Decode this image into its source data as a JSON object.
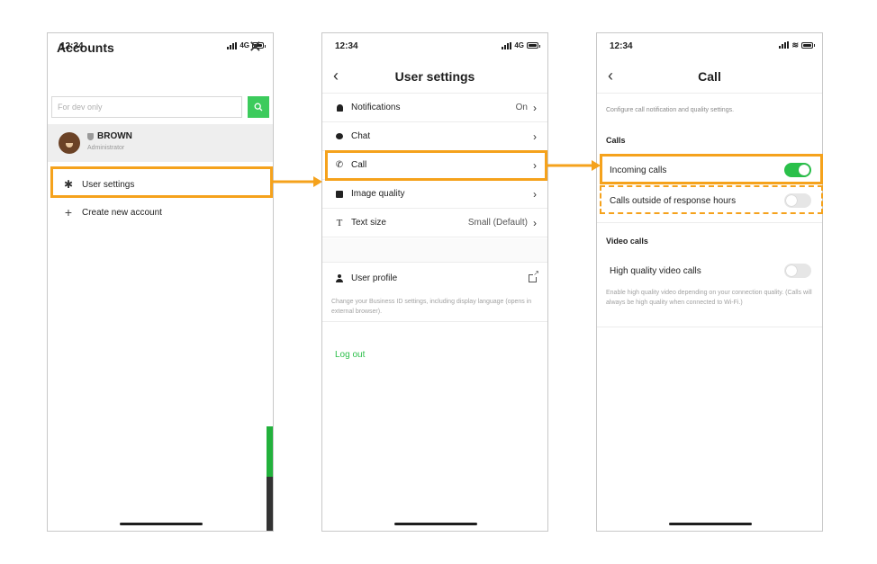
{
  "screens": {
    "accounts": {
      "status": {
        "time": "12:34",
        "network": "4G"
      },
      "title": "Accounts",
      "search": {
        "placeholder": "For dev only",
        "icon": "search-icon"
      },
      "account": {
        "name": "BROWN",
        "role": "Administrator"
      },
      "menu": {
        "user_settings": "User settings",
        "create_account": "Create new account"
      }
    },
    "user_settings": {
      "status": {
        "time": "12:34",
        "network": "4G"
      },
      "title": "User settings",
      "rows": [
        {
          "label": "Notifications",
          "value": "On",
          "icon": "bell-icon"
        },
        {
          "label": "Chat",
          "value": "",
          "icon": "chat-icon"
        },
        {
          "label": "Call",
          "value": "",
          "icon": "phone-icon"
        },
        {
          "label": "Image quality",
          "value": "",
          "icon": "image-icon"
        },
        {
          "label": "Text size",
          "value": "Small (Default)",
          "icon": "text-size-icon"
        }
      ],
      "profile": {
        "label": "User profile"
      },
      "profile_note": "Change your Business ID settings, including display language (opens in external browser).",
      "logout": "Log out"
    },
    "call": {
      "status": {
        "time": "12:34"
      },
      "title": "Call",
      "description": "Configure call notification and quality settings.",
      "calls_section": "Calls",
      "incoming": {
        "label": "Incoming calls",
        "on": true
      },
      "outside_hours": {
        "label": "Calls outside of response hours",
        "on": false
      },
      "video_section": "Video calls",
      "hq_video": {
        "label": "High quality video calls",
        "on": false
      },
      "hq_note": "Enable high quality video depending on your connection quality. (Calls will always be high quality when connected to Wi-Fi.)"
    }
  },
  "colors": {
    "highlight": "#f5a21c",
    "accent_green": "#2ac04a"
  }
}
